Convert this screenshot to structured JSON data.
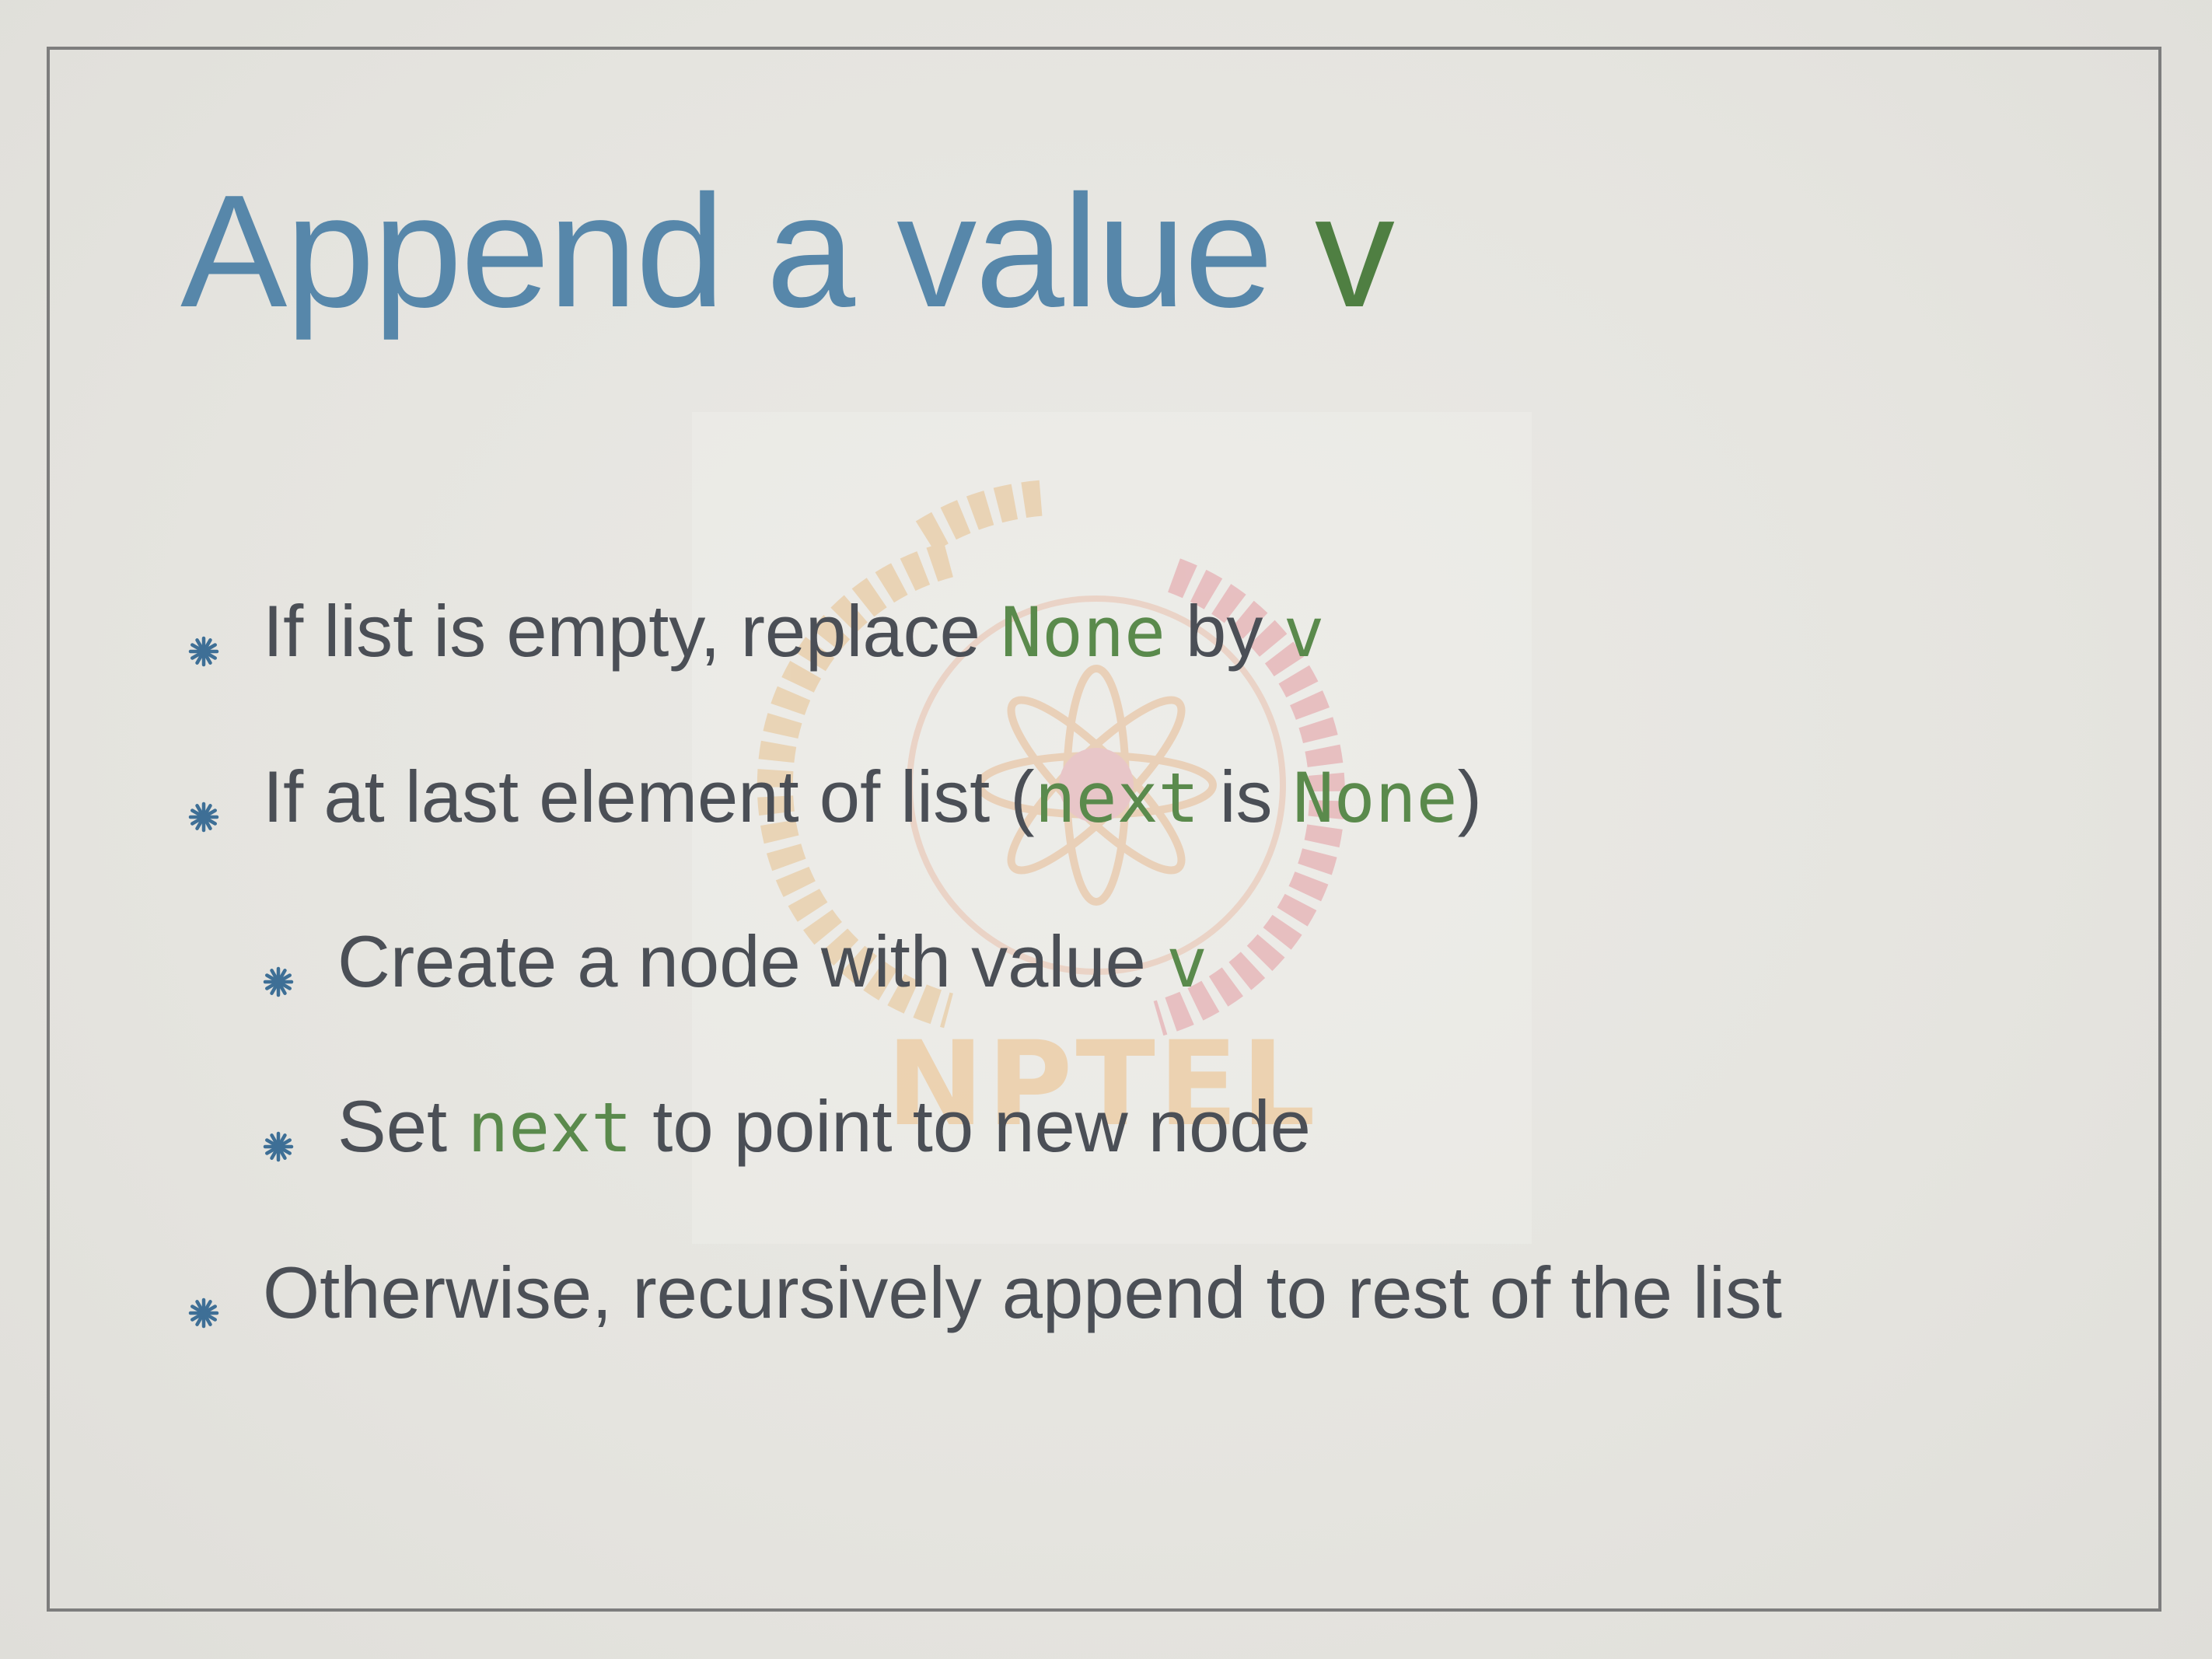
{
  "title": {
    "text": "Append a value ",
    "accent": "v"
  },
  "watermark": {
    "text": "NPTEL"
  },
  "bullets": [
    {
      "level": 1,
      "parts": [
        {
          "text": "If list is empty, replace ",
          "code": false
        },
        {
          "text": "None",
          "code": true
        },
        {
          "text": " by ",
          "code": false
        },
        {
          "text": "v",
          "code": true
        }
      ]
    },
    {
      "level": 1,
      "parts": [
        {
          "text": "If at last element of list (",
          "code": false
        },
        {
          "text": "next",
          "code": true
        },
        {
          "text": " is ",
          "code": false
        },
        {
          "text": "None",
          "code": true
        },
        {
          "text": ")",
          "code": false
        }
      ]
    },
    {
      "level": 2,
      "parts": [
        {
          "text": "Create a node with value ",
          "code": false
        },
        {
          "text": "v",
          "code": true
        }
      ]
    },
    {
      "level": 2,
      "parts": [
        {
          "text": "Set ",
          "code": false
        },
        {
          "text": "next",
          "code": true
        },
        {
          "text": " to point to new node",
          "code": false
        }
      ]
    },
    {
      "level": 1,
      "parts": [
        {
          "text": "Otherwise, recursively append to rest of the list",
          "code": false
        }
      ]
    }
  ],
  "colors": {
    "title": "#5787aa",
    "accent": "#4f7f42",
    "code": "#5a8a4c",
    "body_text": "#4b4f56",
    "bullet_marker": "#3e6f96",
    "frame": "#7d7d7d"
  }
}
